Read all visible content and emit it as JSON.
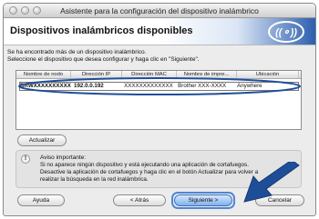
{
  "window": {
    "title": "Asistente para la configuración del dispositivo inalámbrico"
  },
  "header": {
    "title": "Dispositivos inalámbricos disponibles",
    "logo_text": "((⚬))"
  },
  "info": {
    "line1": "Se ha encontrado más de un dispositivo inalámbrico.",
    "line2": "Seleccione el dispositivo que desea configurar y haga clic en \"Siguiente\"."
  },
  "table": {
    "columns": [
      "Nombre de nodo",
      "Dirección IP",
      "Dirección MAC",
      "Nombre de impre...",
      "Ubicación"
    ],
    "rows": [
      [
        "BRWXXXXXXXXXX",
        "192.0.0.192",
        "XXXXXXXXXXXXX",
        "Brother XXX-XXXX",
        "Anywhere"
      ]
    ]
  },
  "buttons": {
    "refresh": "Actualizar",
    "help": "Ayuda",
    "back": "< Atrás",
    "next": "Siguiente >",
    "cancel": "Cancelar"
  },
  "notice": {
    "icon": "!",
    "title": "Aviso importante:",
    "line1": "Si no aparece ningún dispositivo y está ejecutando una aplicación de cortafuegos.",
    "line2": "Desactive la aplicación de cortafuegos y haga clic en el botón Actualizar para volver a",
    "line3": "realizar la búsqueda en la red inalámbrica."
  },
  "colors": {
    "accent": "#2d5fae",
    "arrow": "#1f4e99"
  }
}
